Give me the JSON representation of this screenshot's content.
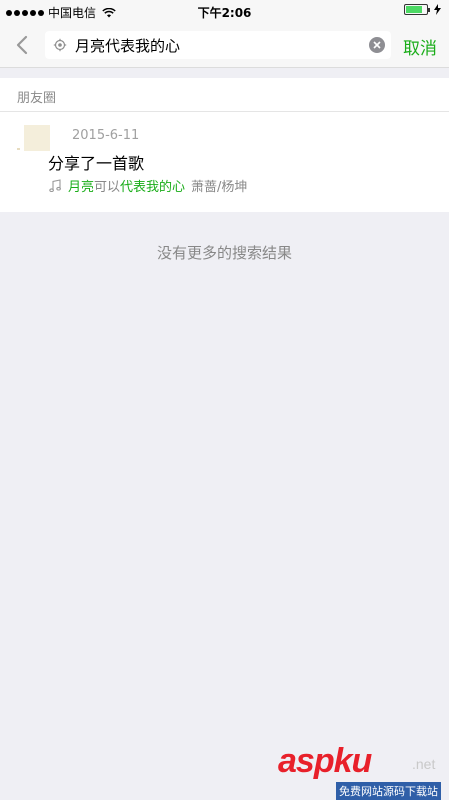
{
  "status_bar": {
    "carrier": "中国电信",
    "time": "下午2:06",
    "icons": [
      "signal-dots",
      "wifi-icon",
      "battery-icon",
      "charging-bolt-icon"
    ]
  },
  "search": {
    "query": "月亮代表我的心",
    "cancel_label": "取消",
    "icons": [
      "back-chevron-icon",
      "search-icon",
      "clear-icon"
    ]
  },
  "section": {
    "title": "朋友圈"
  },
  "results": [
    {
      "date": "2015-6-11",
      "title": "分享了一首歌",
      "music": {
        "icon": "music-note-icon",
        "part1": "月亮",
        "part2": "可以",
        "part3": "代表我的心",
        "artist": "萧蔷/杨坤"
      }
    }
  ],
  "no_more_text": "没有更多的搜索结果",
  "watermark": {
    "logo": "aspku",
    "net": ".net",
    "sub": "免费网站源码下载站"
  },
  "colors": {
    "accent": "#1aad19",
    "background": "#efeff4",
    "header": "#f7f7f7",
    "battery": "#4cd964",
    "watermark_red": "#e8202a"
  },
  "battery_level": 0.8
}
